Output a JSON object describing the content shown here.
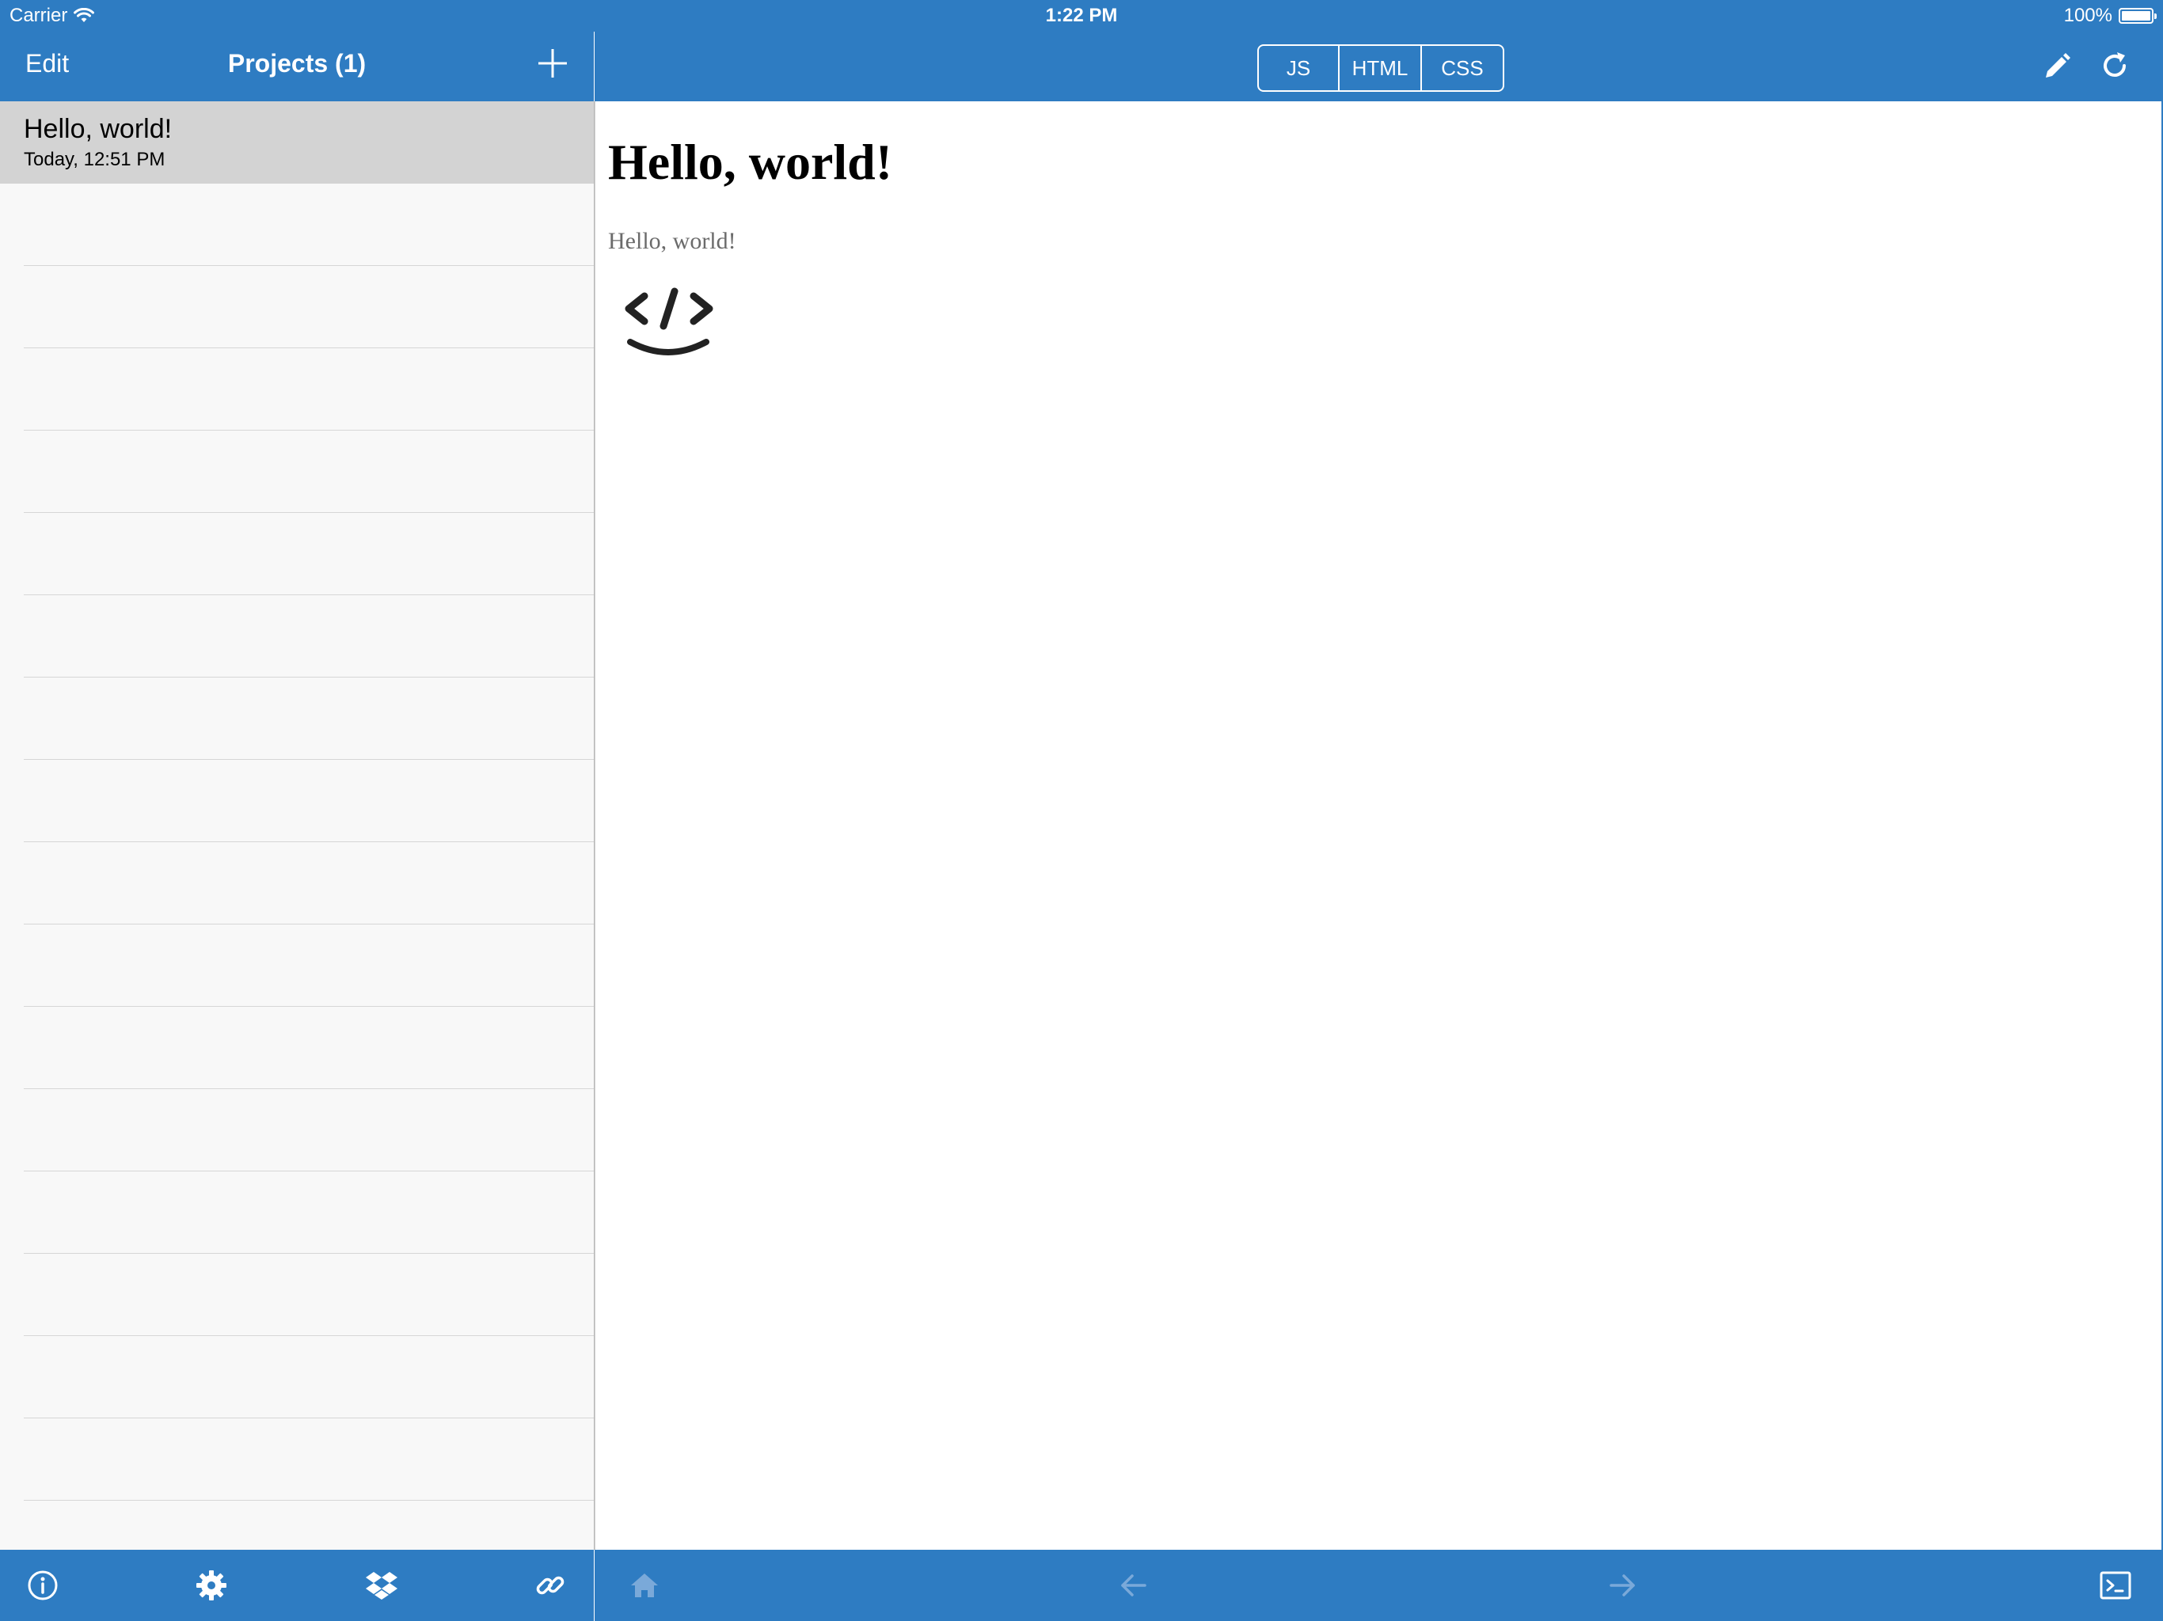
{
  "status_bar": {
    "carrier": "Carrier",
    "time": "1:22 PM",
    "battery": "100%"
  },
  "sidebar": {
    "edit_label": "Edit",
    "title": "Projects (1)",
    "add_icon": "plus-icon",
    "projects": [
      {
        "name": "Hello, world!",
        "date": "Today, 12:51 PM"
      }
    ]
  },
  "editor_nav": {
    "segments": [
      "JS",
      "HTML",
      "CSS"
    ],
    "edit_icon": "pencil-icon",
    "refresh_icon": "refresh-icon"
  },
  "preview": {
    "heading": "Hello, world!",
    "paragraph": "Hello, world!",
    "logo_icon": "code-smile-icon"
  },
  "left_toolbar": {
    "icons": [
      "info-icon",
      "gear-icon",
      "dropbox-icon",
      "link-icon"
    ]
  },
  "right_toolbar": {
    "icons": [
      "home-icon",
      "back-arrow-icon",
      "forward-arrow-icon",
      "console-icon"
    ]
  },
  "colors": {
    "accent": "#2e7cc2",
    "selected_row": "#d3d3d3",
    "sidebar_bg": "#f8f8f8"
  }
}
